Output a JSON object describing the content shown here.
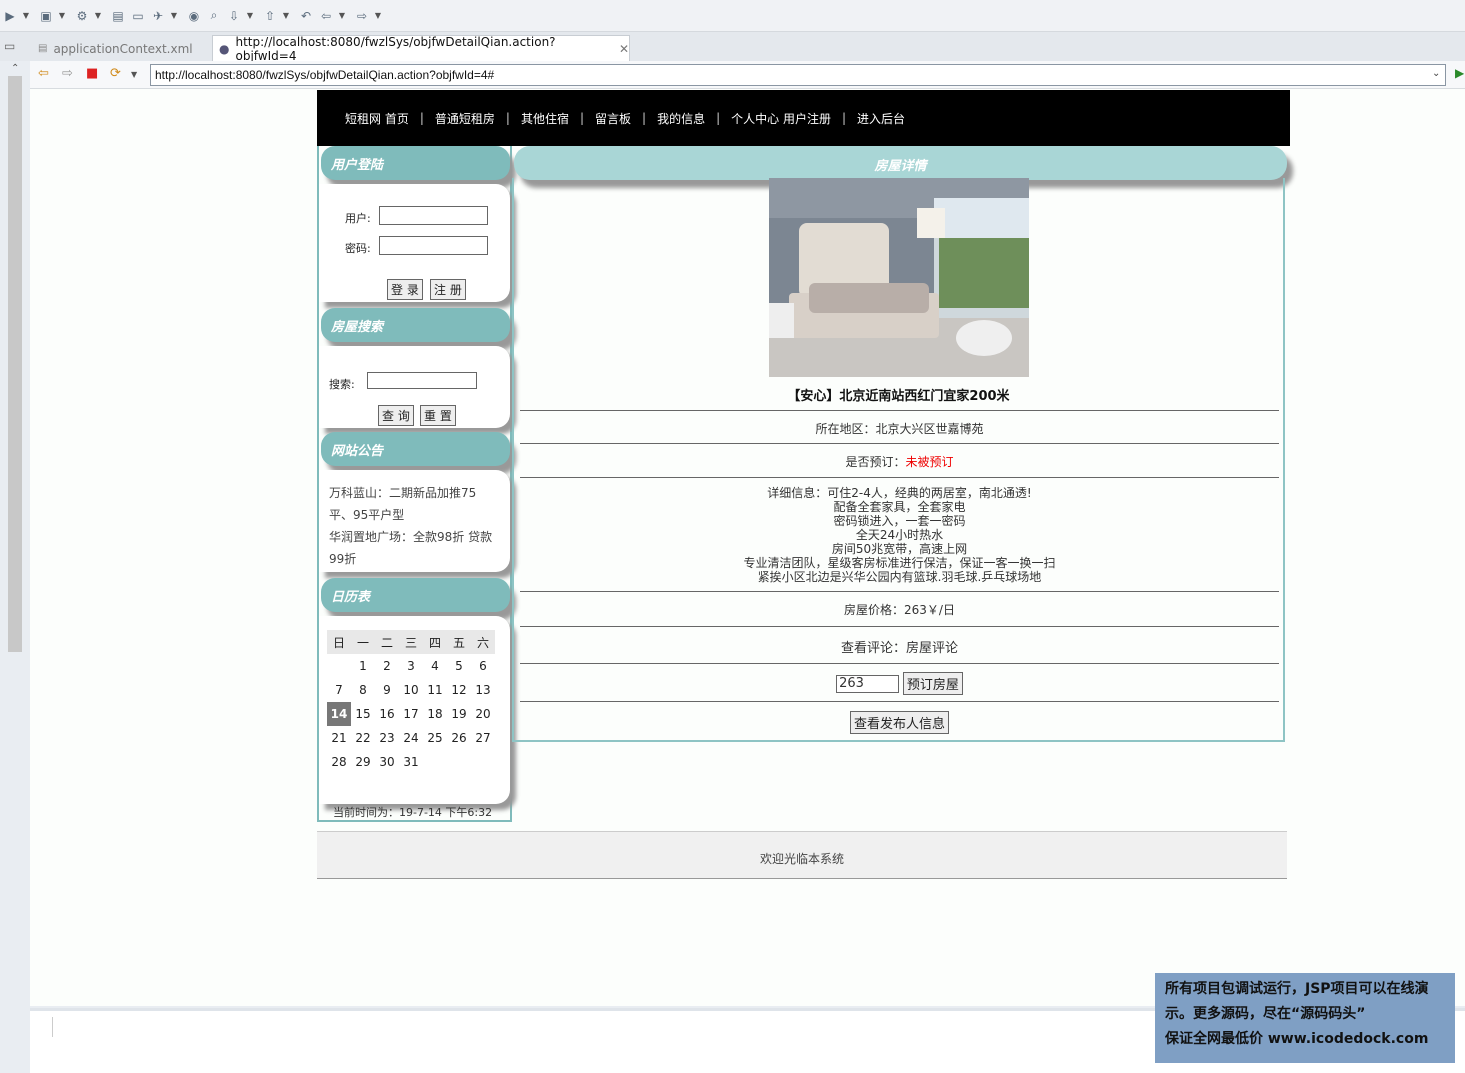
{
  "tabs": {
    "inactive": "applicationContext.xml",
    "active": "http://localhost:8080/fwzlSys/objfwDetailQian.action?objfwId=4"
  },
  "url": "http://localhost:8080/fwzlSys/objfwDetailQian.action?objfwId=4#",
  "topnav": [
    "短租网 首页",
    "普通短租房",
    "其他住宿",
    "留言板",
    "我的信息",
    "个人中心 用户注册",
    "进入后台"
  ],
  "login": {
    "title": "用户登陆",
    "user_label": "用户:",
    "pass_label": "密码:",
    "login_btn": "登 录",
    "register_btn": "注 册"
  },
  "search": {
    "title": "房屋搜索",
    "label": "搜索:",
    "query_btn": "查 询",
    "reset_btn": "重 置"
  },
  "notice": {
    "title": "网站公告",
    "items": [
      "万科蓝山：二期新品加推75平、95平户型",
      "华润置地广场：全款98折 贷款99折"
    ]
  },
  "calendar": {
    "title": "日历表",
    "weekdays": [
      "日",
      "一",
      "二",
      "三",
      "四",
      "五",
      "六"
    ],
    "today": "14",
    "now_text": "当前时间为：19-7-14 下午6:32"
  },
  "detail": {
    "title": "房屋详情",
    "name": "【安心】北京近南站西红门宜家200米",
    "region_label": "所在地区：",
    "region": "北京大兴区世嘉博苑",
    "booked_label": "是否预订：",
    "booked": "未被预订",
    "info_label": "详细信息：",
    "info_lines": [
      "可住2-4人，经典的两居室，南北通透!",
      "配备全套家具，全套家电",
      "密码锁进入，一套一密码",
      "全天24小时热水",
      "房间50兆宽带，高速上网",
      "专业清洁团队，星级客房标准进行保洁，保证一客一换一扫",
      "紧挨小区北边是兴华公园内有篮球.羽毛球.乒乓球场地"
    ],
    "price_label": "房屋价格：",
    "price": "263￥/日",
    "comment_label": "查看评论：",
    "comment_link": "房屋评论",
    "price_input": "263",
    "book_btn": "预订房屋",
    "publisher_btn": "查看发布人信息"
  },
  "footer": "欢迎光临本系统",
  "watermark": [
    "所有项目包调试运行，JSP项目可以在线演",
    "示。更多源码，尽在“源码码头”",
    "保证全网最低价 www.icodedock.com"
  ]
}
